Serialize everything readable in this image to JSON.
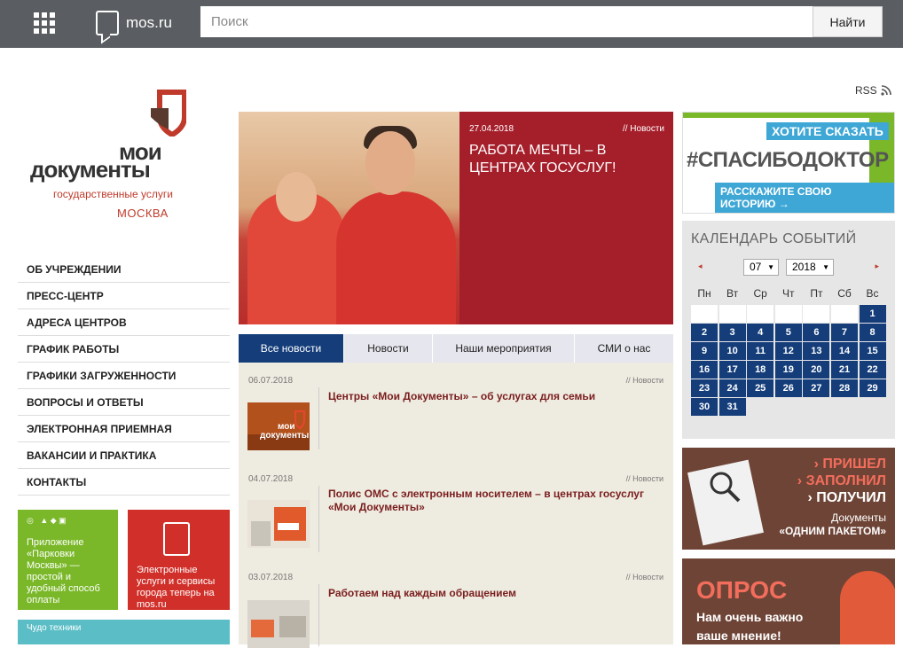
{
  "topbar": {
    "logo_text": "mos.ru",
    "search_placeholder": "Поиск",
    "search_button": "Найти"
  },
  "rss": "RSS",
  "logo": {
    "line1": "мои",
    "line2": "документы",
    "subtitle": "государственные услуги",
    "city": "МОСКВА"
  },
  "nav": [
    "ОБ УЧРЕЖДЕНИИ",
    "ПРЕСС-ЦЕНТР",
    "АДРЕСА ЦЕНТРОВ",
    "ГРАФИК РАБОТЫ",
    "ГРАФИКИ ЗАГРУЖЕННОСТИ",
    "ВОПРОСЫ И ОТВЕТЫ",
    "ЭЛЕКТРОННАЯ ПРИЕМНАЯ",
    "ВАКАНСИИ И ПРАКТИКА",
    "КОНТАКТЫ"
  ],
  "promos": {
    "parking_text": "Приложение «Парковки Москвы» — простой и удобный способ оплаты",
    "eservices_text": "Электронные услуги и сервисы города теперь на mos.ru",
    "chudo_text": "Чудо техники"
  },
  "hero": {
    "date": "27.04.2018",
    "category": "// Новости",
    "title": "РАБОТА МЕЧТЫ – В ЦЕНТРАХ ГОСУСЛУГ!"
  },
  "tabs": [
    "Все новости",
    "Новости",
    "Наши мероприятия",
    "СМИ о нас"
  ],
  "news": [
    {
      "date": "06.07.2018",
      "category": "// Новости",
      "title": "Центры «Мои Документы» – об услугах для семьи"
    },
    {
      "date": "04.07.2018",
      "category": "// Новости",
      "title": "Полис ОМС с электронным носителем – в центрах госуслуг «Мои Документы»"
    },
    {
      "date": "03.07.2018",
      "category": "// Новости",
      "title": "Работаем над каждым обращением"
    }
  ],
  "spasibo": {
    "top": "ХОТИТЕ СКАЗАТЬ",
    "mid": "#СПАСИБОДОКТОР",
    "bottom": "РАССКАЖИТЕ СВОЮ ИСТОРИЮ →"
  },
  "calendar": {
    "title": "КАЛЕНДАРЬ СОБЫТИЙ",
    "prev": "◂",
    "next": "▸",
    "month": "07",
    "year": "2018",
    "weekdays": [
      "Пн",
      "Вт",
      "Ср",
      "Чт",
      "Пт",
      "Сб",
      "Вс"
    ],
    "cells": [
      "",
      "",
      "",
      "",
      "",
      "",
      "1",
      "2",
      "3",
      "4",
      "5",
      "6",
      "7",
      "8",
      "9",
      "10",
      "11",
      "12",
      "13",
      "14",
      "15",
      "16",
      "17",
      "18",
      "19",
      "20",
      "21",
      "22",
      "23",
      "24",
      "25",
      "26",
      "27",
      "28",
      "29",
      "30",
      "31"
    ]
  },
  "paket": {
    "line1": "› ПРИШЕЛ",
    "line2": "› ЗАПОЛНИЛ",
    "line3": "› ПОЛУЧИЛ",
    "sub1": "Документы",
    "sub2": "«ОДНИМ ПАКЕТОМ»"
  },
  "opros": {
    "title": "ОПРОС",
    "sub1": "Нам очень важно",
    "sub2": "ваше мнение!"
  },
  "colors": {
    "topbar": "#5a5d61",
    "brand_red": "#a51f2b",
    "calendar_blue": "#143d7a",
    "accent_green": "#7ab829"
  }
}
